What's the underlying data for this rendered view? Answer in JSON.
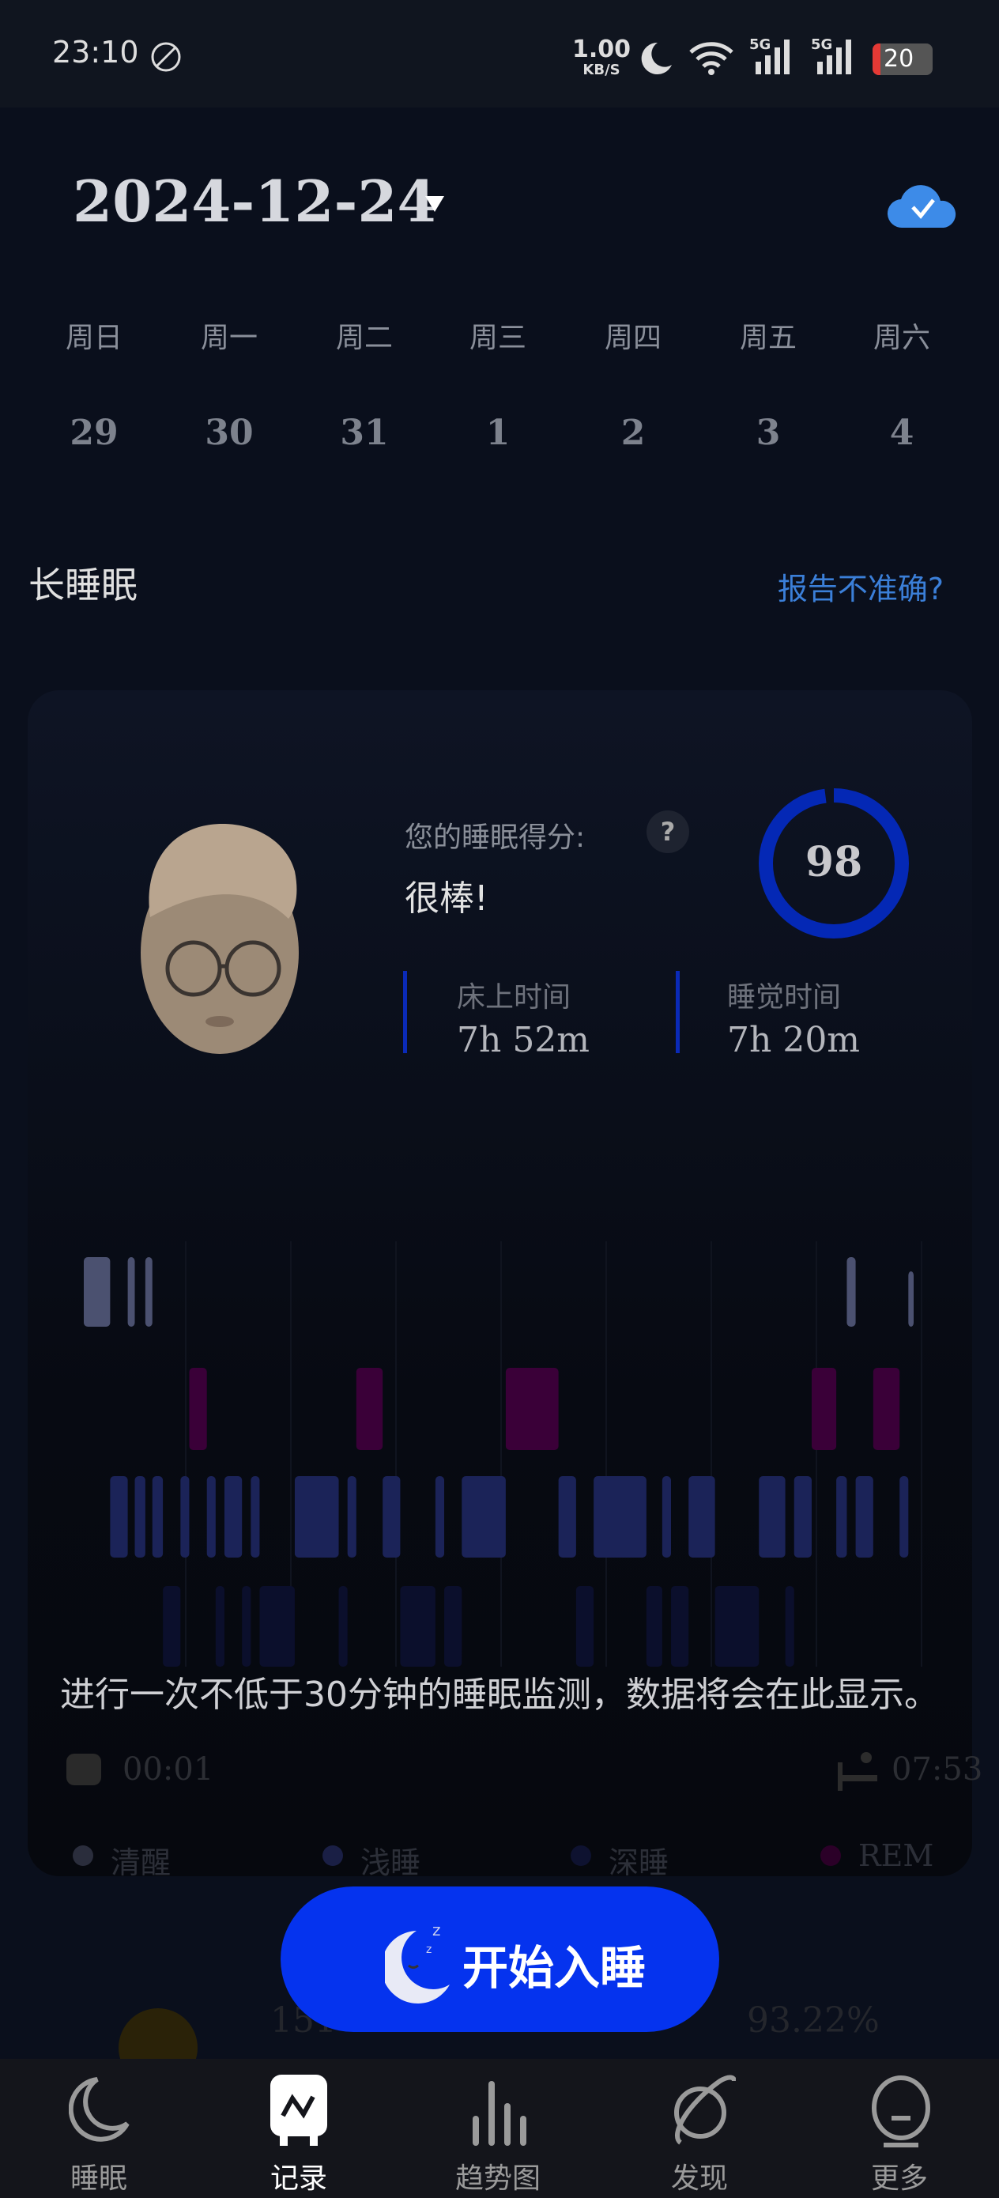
{
  "status_bar": {
    "time": "23:10",
    "net_speed": "1.00",
    "net_unit": "KB/S",
    "signal1": "5G",
    "signal2": "5G",
    "battery": "20",
    "icons": [
      "ad-block-icon",
      "moon-icon",
      "wifi-icon",
      "signal-icon",
      "battery-icon"
    ]
  },
  "header": {
    "date": "2024-12-24",
    "dropdown_icon": "triangle-down-icon",
    "sync_icon": "cloud-check-icon"
  },
  "week": {
    "days": [
      "周日",
      "周一",
      "周二",
      "周三",
      "周四",
      "周五",
      "周六"
    ],
    "dates": [
      "29",
      "30",
      "31",
      "1",
      "2",
      "3",
      "4"
    ]
  },
  "section": {
    "title": "长睡眠",
    "report_link": "报告不准确?"
  },
  "summary": {
    "score_label": "您的睡眠得分:",
    "help": "?",
    "rating": "很棒!",
    "score": "98",
    "score_percent": 98,
    "bed_label": "床上时间",
    "bed_value": "7h 52m",
    "sleep_label": "睡觉时间",
    "sleep_value": "7h 20m"
  },
  "chart_data": {
    "type": "hypnogram",
    "stages": [
      "awake",
      "rem",
      "light",
      "deep"
    ],
    "colors": {
      "awake": "#4b5170",
      "rem": "#3a0038",
      "light": "#1b2358",
      "deep": "#0b0f2c"
    },
    "x_start": "00:01",
    "x_end": "07:53",
    "total_minutes": 472,
    "segments": [
      [
        "awake",
        0,
        15
      ],
      [
        "light",
        15,
        25
      ],
      [
        "awake",
        25,
        29
      ],
      [
        "light",
        29,
        35
      ],
      [
        "awake",
        35,
        39
      ],
      [
        "light",
        39,
        45
      ],
      [
        "deep",
        45,
        55
      ],
      [
        "light",
        55,
        60
      ],
      [
        "rem",
        60,
        70
      ],
      [
        "light",
        70,
        75
      ],
      [
        "deep",
        75,
        80
      ],
      [
        "light",
        80,
        90
      ],
      [
        "deep",
        90,
        95
      ],
      [
        "light",
        95,
        100
      ],
      [
        "deep",
        100,
        120
      ],
      [
        "light",
        120,
        145
      ],
      [
        "deep",
        145,
        150
      ],
      [
        "light",
        150,
        155
      ],
      [
        "rem",
        155,
        170
      ],
      [
        "light",
        170,
        180
      ],
      [
        "deep",
        180,
        200
      ],
      [
        "light",
        200,
        205
      ],
      [
        "deep",
        205,
        215
      ],
      [
        "light",
        215,
        240
      ],
      [
        "rem",
        240,
        270
      ],
      [
        "light",
        270,
        280
      ],
      [
        "deep",
        280,
        290
      ],
      [
        "light",
        290,
        320
      ],
      [
        "deep",
        320,
        329
      ],
      [
        "light",
        329,
        334
      ],
      [
        "deep",
        334,
        344
      ],
      [
        "light",
        344,
        359
      ],
      [
        "deep",
        359,
        384
      ],
      [
        "light",
        384,
        399
      ],
      [
        "deep",
        399,
        404
      ],
      [
        "light",
        404,
        414
      ],
      [
        "rem",
        414,
        428
      ],
      [
        "light",
        428,
        434
      ],
      [
        "awake",
        434,
        439
      ],
      [
        "light",
        439,
        449
      ],
      [
        "rem",
        449,
        464
      ],
      [
        "light",
        464,
        469
      ],
      [
        "awake",
        469,
        472
      ]
    ],
    "legend": [
      "清醒",
      "浅睡",
      "深睡",
      "REM"
    ]
  },
  "empty_message": "进行一次不低于30分钟的睡眠监测，数据将会在此显示。",
  "stats": {
    "left": "151",
    "right": "93.22%"
  },
  "start_button": {
    "label": "开始入睡",
    "icon": "sleeping-moon-icon"
  },
  "nav": [
    {
      "label": "睡眠",
      "icon": "moon-icon"
    },
    {
      "label": "记录",
      "icon": "record-icon",
      "active": true
    },
    {
      "label": "趋势图",
      "icon": "bar-chart-icon"
    },
    {
      "label": "发现",
      "icon": "planet-icon"
    },
    {
      "label": "更多",
      "icon": "robot-icon"
    }
  ]
}
